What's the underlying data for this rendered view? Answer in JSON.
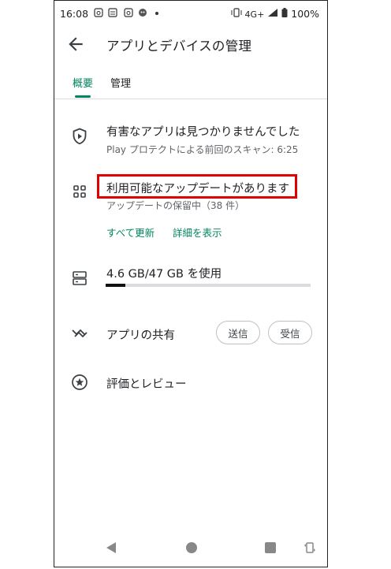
{
  "status_bar": {
    "time": "16:08",
    "network": "4G+",
    "battery": "100%"
  },
  "header": {
    "title": "アプリとデバイスの管理"
  },
  "tabs": [
    {
      "label": "概要",
      "active": true
    },
    {
      "label": "管理",
      "active": false
    }
  ],
  "protect": {
    "title": "有害なアプリは見つかりませんでした",
    "subtitle": "Play プロテクトによる前回のスキャン: 6:25"
  },
  "updates": {
    "title": "利用可能なアップデートがあります",
    "subtitle": "アップデートの保留中（38 件）",
    "update_all": "すべて更新",
    "show_details": "詳細を表示"
  },
  "storage": {
    "label": "4.6 GB/47 GB を使用",
    "used_fraction": 0.098
  },
  "share": {
    "label": "アプリの共有",
    "send": "送信",
    "receive": "受信"
  },
  "ratings": {
    "label": "評価とレビュー"
  },
  "colors": {
    "accent": "#01875f",
    "highlight": "#e00000"
  }
}
